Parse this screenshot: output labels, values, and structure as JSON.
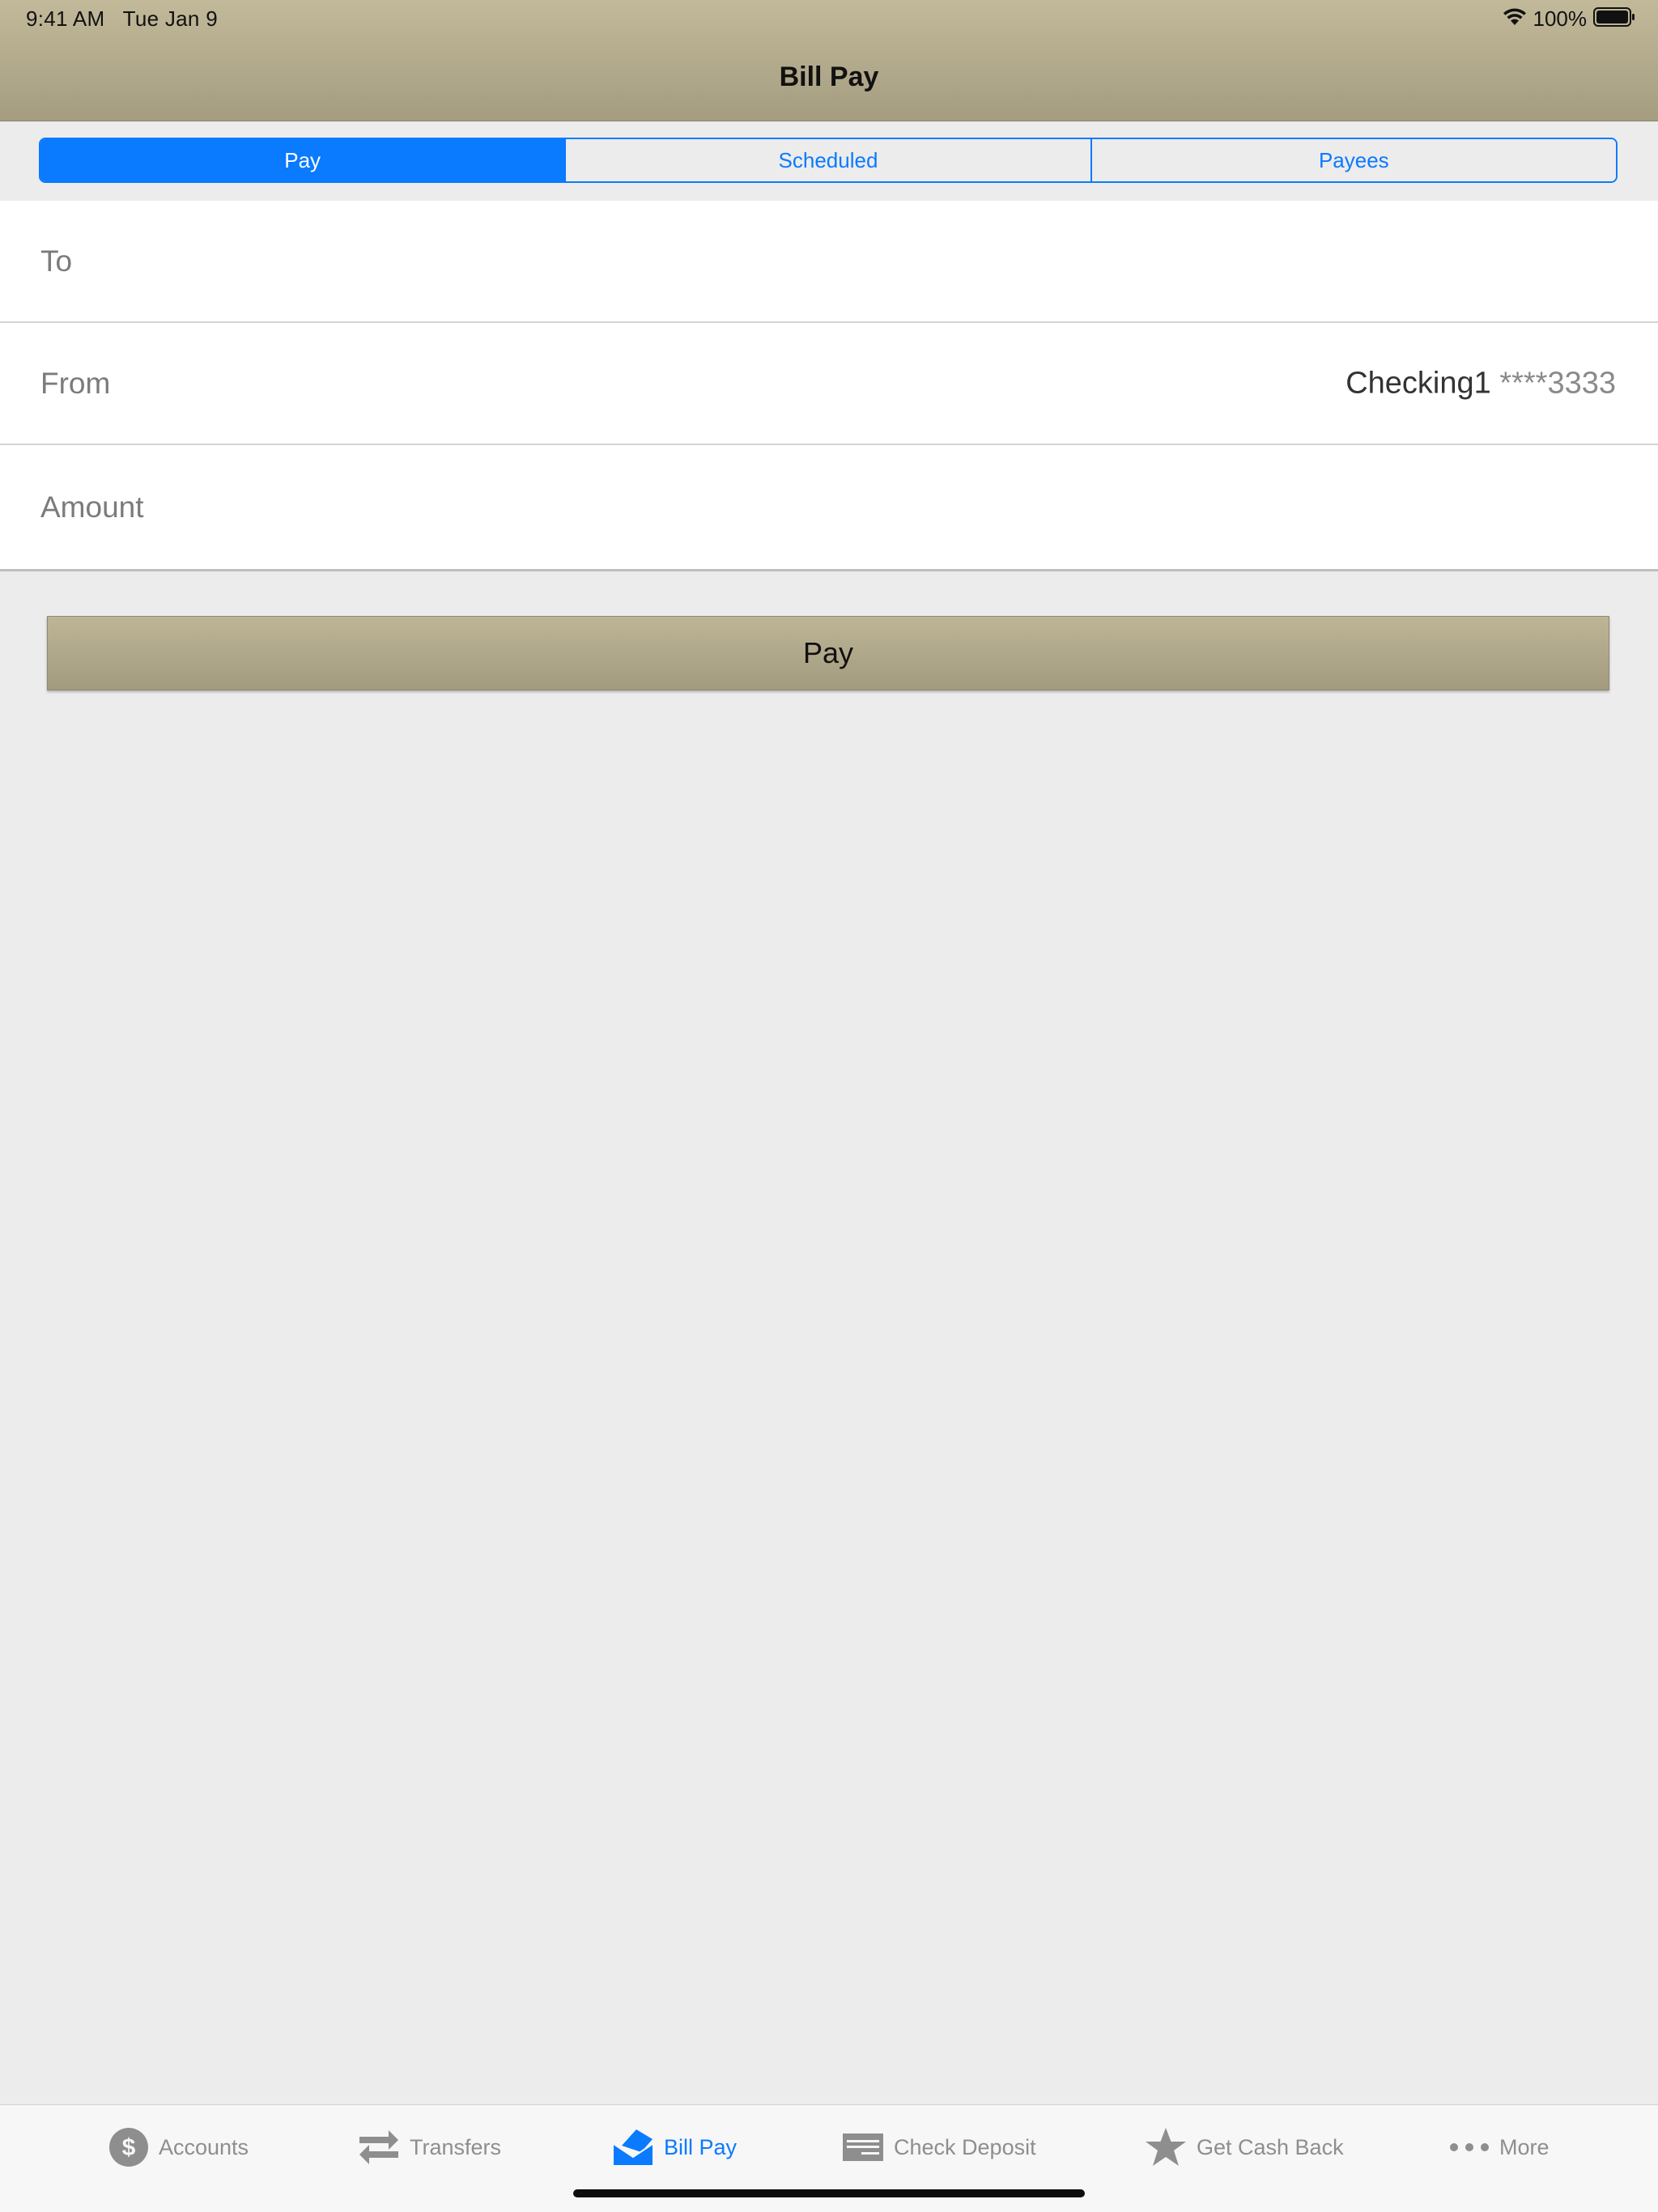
{
  "status_bar": {
    "time": "9:41 AM",
    "date": "Tue Jan 9",
    "battery_percent": "100%"
  },
  "nav": {
    "title": "Bill Pay"
  },
  "segments": [
    {
      "label": "Pay",
      "active": true
    },
    {
      "label": "Scheduled",
      "active": false
    },
    {
      "label": "Payees",
      "active": false
    }
  ],
  "form": {
    "to_label": "To",
    "from_label": "From",
    "from_account_name": "Checking1",
    "from_account_mask": "****3333",
    "amount_label": "Amount"
  },
  "pay_button_label": "Pay",
  "tabbar": {
    "items": [
      {
        "label": "Accounts",
        "icon": "dollar-circle-icon",
        "active": false
      },
      {
        "label": "Transfers",
        "icon": "transfer-arrows-icon",
        "active": false
      },
      {
        "label": "Bill Pay",
        "icon": "envelope-bill-icon",
        "active": true
      },
      {
        "label": "Check Deposit",
        "icon": "check-icon",
        "active": false
      },
      {
        "label": "Get Cash Back",
        "icon": "star-icon",
        "active": false
      },
      {
        "label": "More",
        "icon": "more-dots-icon",
        "active": false
      }
    ]
  },
  "colors": {
    "accent": "#0A7AFF",
    "nav_gradient_top": "#C1B999",
    "nav_gradient_bottom": "#A59D80",
    "background": "#ECECEC",
    "tab_inactive": "#8E8E8E"
  }
}
